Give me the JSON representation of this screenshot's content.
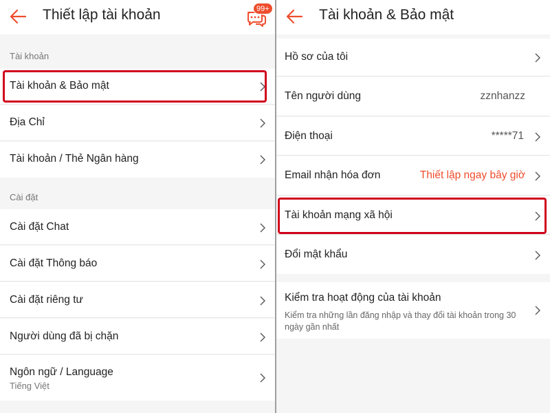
{
  "left": {
    "title": "Thiết lập tài khoản",
    "badge": "99+",
    "icons": {
      "back": "back-arrow-icon",
      "chat": "chat-bubbles-icon"
    },
    "section_account": "Tài khoản",
    "account_items": [
      "Tài khoản & Bảo mật",
      "Địa Chỉ",
      "Tài khoản / Thẻ Ngân hàng"
    ],
    "section_settings": "Cài đặt",
    "settings_items": [
      "Cài đặt Chat",
      "Cài đặt Thông báo",
      "Cài đặt riêng tư",
      "Người dùng đã bị chặn"
    ],
    "language": {
      "label": "Ngôn ngữ / Language",
      "value": "Tiếng Việt"
    }
  },
  "right": {
    "title": "Tài khoản & Bảo mật",
    "icons": {
      "back": "back-arrow-icon"
    },
    "items": {
      "profile": "Hồ sơ của tôi",
      "username_label": "Tên người dùng",
      "username_value": "zznhanzz",
      "phone_label": "Điện thoại",
      "phone_value": "*****71",
      "email_label": "Email nhận hóa đơn",
      "email_value": "Thiết lập ngay bây giờ",
      "social": "Tài khoản mạng xã hội",
      "password": "Đổi mật khẩu"
    },
    "activity": {
      "title": "Kiểm tra hoạt động của tài khoản",
      "desc": "Kiểm tra những lần đăng nhập và thay đổi tài khoản trong 30 ngày gần nhất"
    }
  },
  "colors": {
    "accent": "#ee4d2d",
    "highlight": "#d0021b",
    "background": "#f5f5f5"
  }
}
